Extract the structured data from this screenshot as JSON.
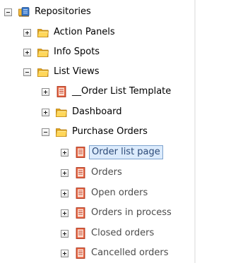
{
  "tree": {
    "root": {
      "label": "Repositories",
      "icon": "repository-icon",
      "toggle": "collapse"
    },
    "action_panels": {
      "label": "Action Panels",
      "icon": "folder-icon",
      "toggle": "expand"
    },
    "info_spots": {
      "label": "Info Spots",
      "icon": "folder-icon",
      "toggle": "expand"
    },
    "list_views": {
      "label": "List Views",
      "icon": "folder-icon",
      "toggle": "collapse"
    },
    "order_list_template": {
      "label": "__Order List Template",
      "icon": "document-icon",
      "toggle": "expand"
    },
    "dashboard": {
      "label": "Dashboard",
      "icon": "folder-icon",
      "toggle": "expand"
    },
    "purchase_orders": {
      "label": "Purchase Orders",
      "icon": "folder-icon",
      "toggle": "collapse"
    },
    "order_list_page": {
      "label": "Order list page",
      "icon": "document-icon",
      "toggle": "expand",
      "selected": true
    },
    "orders": {
      "label": "Orders",
      "icon": "document-icon",
      "toggle": "expand"
    },
    "open_orders": {
      "label": "Open orders",
      "icon": "document-icon",
      "toggle": "expand"
    },
    "orders_in_process": {
      "label": "Orders in process",
      "icon": "document-icon",
      "toggle": "expand"
    },
    "closed_orders": {
      "label": "Closed orders",
      "icon": "document-icon",
      "toggle": "expand"
    },
    "cancelled_orders": {
      "label": "Cancelled orders",
      "icon": "document-icon",
      "toggle": "expand"
    }
  },
  "colors": {
    "selection_background": "#dcebfc",
    "selection_border": "#7da2ce",
    "folder_yellow": "#f4c542",
    "document_red": "#c8402a"
  }
}
